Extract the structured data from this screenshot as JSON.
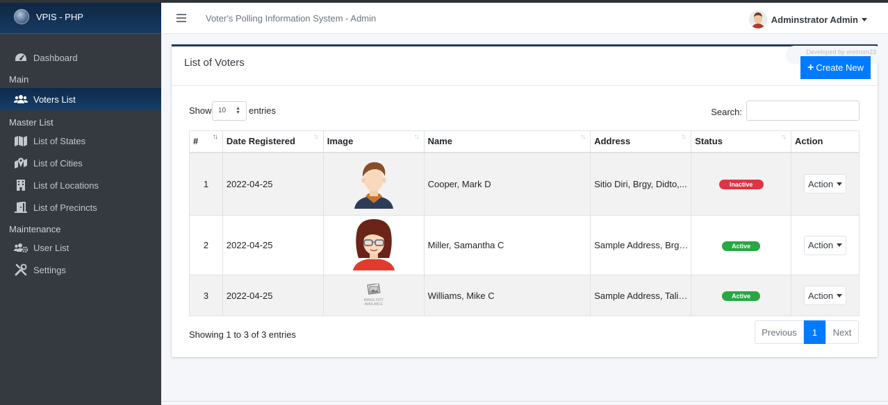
{
  "brand": {
    "name": "VPIS - PHP"
  },
  "sidebar": {
    "items": [
      {
        "label": "Dashboard",
        "type": "item",
        "icon": "dashboard-icon"
      },
      {
        "label": "Main",
        "type": "header"
      },
      {
        "label": "Voters List",
        "type": "item",
        "icon": "users-icon",
        "active": true
      },
      {
        "label": "Master List",
        "type": "header"
      },
      {
        "label": "List of States",
        "type": "item",
        "icon": "map-icon"
      },
      {
        "label": "List of Cities",
        "type": "item",
        "icon": "map-marked-icon"
      },
      {
        "label": "List of Locations",
        "type": "item",
        "icon": "building-icon"
      },
      {
        "label": "List of Precincts",
        "type": "item",
        "icon": "door-icon"
      },
      {
        "label": "Maintenance",
        "type": "header"
      },
      {
        "label": "User List",
        "type": "item",
        "icon": "users-cog-icon"
      },
      {
        "label": "Settings",
        "type": "item",
        "icon": "tools-icon"
      }
    ]
  },
  "navbar": {
    "title": "Voter's Polling Information System - Admin",
    "user_name": "Adminstrator Admin"
  },
  "card": {
    "title": "List of Voters",
    "developer_credit": "Developed by oretnom23",
    "create_label": "Create New"
  },
  "controls": {
    "show_label": "Show",
    "entries_value": "10",
    "entries_label": "entries",
    "search_label": "Search:",
    "search_value": ""
  },
  "table": {
    "columns": [
      "#",
      "Date Registered",
      "Image",
      "Name",
      "Address",
      "Status",
      "Action"
    ],
    "rows": [
      {
        "num": "1",
        "date": "2022-04-25",
        "image": "male-avatar",
        "name": "Cooper, Mark D",
        "address": "Sitio Diri, Brgy, Didto,...",
        "status": "Inactive",
        "action": "Action"
      },
      {
        "num": "2",
        "date": "2022-04-25",
        "image": "female-avatar",
        "name": "Miller, Samantha C",
        "address": "Sample Address, Brgy,...",
        "status": "Active",
        "action": "Action"
      },
      {
        "num": "3",
        "date": "2022-04-25",
        "image": "image-not-available",
        "name": "Williams, Mike C",
        "address": "Sample Address, Talis...",
        "status": "Active",
        "action": "Action"
      }
    ],
    "image_placeholder_text": "IMAGE NOT AVAILABLE"
  },
  "footer": {
    "info": "Showing 1 to 3 of 3 entries",
    "prev_label": "Previous",
    "current_page": "1",
    "next_label": "Next"
  },
  "colors": {
    "primary": "#007bff",
    "sidebar": "#343a40",
    "active_nav": "#173f6b",
    "status_active": "#28a745",
    "status_inactive": "#dc3545"
  }
}
